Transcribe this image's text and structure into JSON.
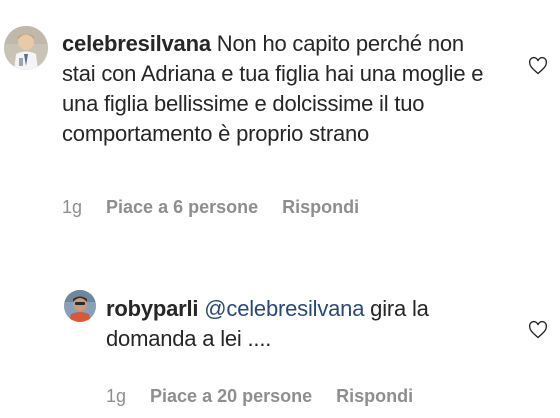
{
  "comments": [
    {
      "username": "celebresilvana",
      "text": "Non ho capito perché non stai con Adriana e tua figlia hai una moglie e una figlia bellissime e dolcissime il tuo comportamento è proprio strano",
      "time": "1g",
      "likes": "Piace a 6 persone",
      "reply": "Rispondi",
      "avatar_icon": "avatar-child-photo",
      "like_icon": "heart-outline-icon"
    },
    {
      "username": "robyparli",
      "mention": "@celebresilvana",
      "text": "gira la domanda a lei ....",
      "time": "1g",
      "likes": "Piace a 20 persone",
      "reply": "Rispondi",
      "avatar_icon": "avatar-man-photo",
      "like_icon": "heart-outline-icon"
    }
  ],
  "colors": {
    "text": "#262626",
    "muted": "#8e8e8e",
    "mention": "#2a4a75"
  }
}
